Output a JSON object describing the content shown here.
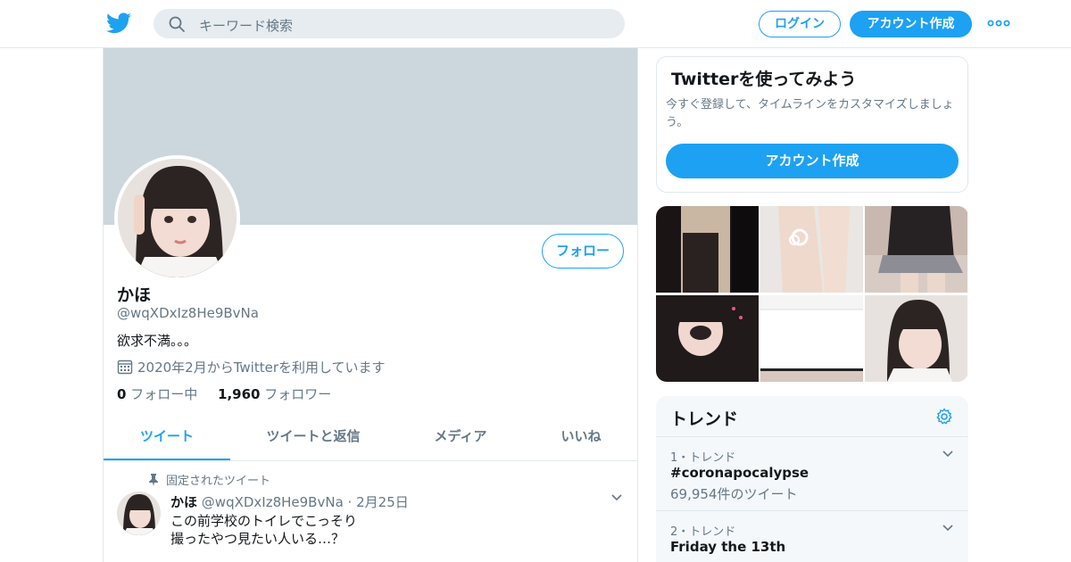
{
  "header": {
    "search_placeholder": "キーワード検索",
    "login_label": "ログイン",
    "signup_label": "アカウント作成",
    "icons": [
      "twitter-bird-icon",
      "search-icon",
      "more-dots-icon"
    ]
  },
  "profile": {
    "name": "かほ",
    "handle": "@wqXDxIz8He9BvNa",
    "bio": "欲求不満。。。",
    "joined": "2020年2月からTwitterを利用しています",
    "following_count": "0",
    "following_label": "フォロー中",
    "followers_count": "1,960",
    "followers_label": "フォロワー",
    "follow_button": "フォロー",
    "tabs": [
      "ツイート",
      "ツイートと返信",
      "メディア",
      "いいね"
    ],
    "active_tab": 0
  },
  "pinned_tweet": {
    "pinned_label": "固定されたツイート",
    "author_name": "かほ",
    "author_handle": "@wqXDxIz8He9BvNa",
    "date": "2月25日",
    "line1": "この前学校のトイレでこっそり",
    "line2": "撮ったやつ見たい人いる…？"
  },
  "signup_card": {
    "title": "Twitterを使ってみよう",
    "subtitle": "今すぐ登録して、タイムラインをカスタマイズしましょう。",
    "button": "アカウント作成"
  },
  "trends": {
    "title": "トレンド",
    "items": [
      {
        "meta": "1・トレンド",
        "name": "#coronapocalypse",
        "count": "69,954件のツイート"
      },
      {
        "meta": "2・トレンド",
        "name": "Friday the 13th",
        "count": ""
      }
    ]
  },
  "colors": {
    "accent": "#1da1f2",
    "banner": "#ccd6dd",
    "muted_text": "#657786",
    "border": "#e1e8ed",
    "trends_bg": "#f5f8fa"
  }
}
